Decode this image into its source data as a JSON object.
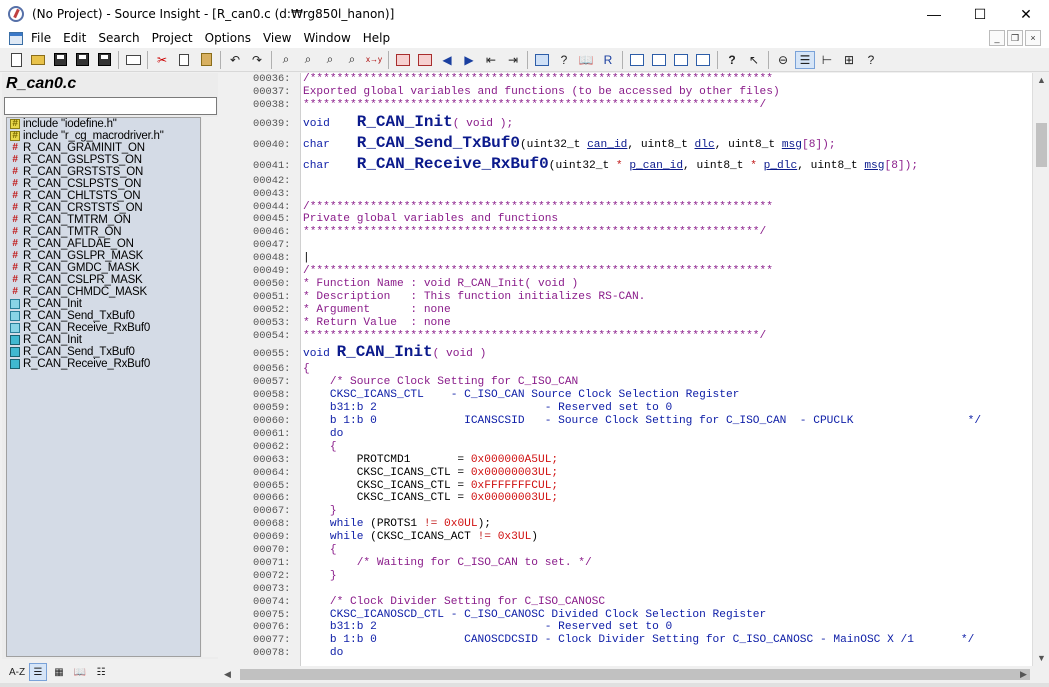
{
  "window": {
    "title": "(No Project) - Source Insight - [R_can0.c (d:₩rg850l_hanon)]",
    "minimize": "—",
    "maximize": "☐",
    "close": "✕"
  },
  "menu": [
    "File",
    "Edit",
    "Search",
    "Project",
    "Options",
    "View",
    "Window",
    "Help"
  ],
  "mdi": {
    "min": "_",
    "restore": "❒",
    "close": "×"
  },
  "toolbar_icons": [
    "new-file-icon",
    "open-folder-icon",
    "save-icon",
    "save-all-icon",
    "save-as-icon",
    "print-icon",
    "cut-icon",
    "copy-icon",
    "paste-icon",
    "undo-icon",
    "redo-icon",
    "find-icon",
    "find-next-icon",
    "find-prev-icon",
    "find-in-files-icon",
    "replace-icon",
    "bookmark-prev-icon",
    "bookmark-next-icon",
    "back-icon",
    "forward-icon",
    "indent-left-icon",
    "indent-right-icon",
    "lookup-icon",
    "references-icon",
    "browse-icon",
    "relation-icon",
    "symbol-window-icon",
    "context-window-icon",
    "relation-window-icon",
    "project-window-icon",
    "help-icon",
    "pointer-help-icon",
    "sync-icon",
    "layout-icon",
    "tree-icon",
    "layout-toggle-icon"
  ],
  "sidebar": {
    "file_title": "R_can0.c",
    "search_value": "",
    "symbols": [
      {
        "kind": "include",
        "label": "include \"iodefine.h\""
      },
      {
        "kind": "include",
        "label": "include \"r_cg_macrodriver.h\""
      },
      {
        "kind": "define",
        "label": "R_CAN_GRAMINIT_ON"
      },
      {
        "kind": "define",
        "label": "R_CAN_GSLPSTS_ON"
      },
      {
        "kind": "define",
        "label": "R_CAN_GRSTSTS_ON"
      },
      {
        "kind": "define",
        "label": "R_CAN_CSLPSTS_ON"
      },
      {
        "kind": "define",
        "label": "R_CAN_CHLTSTS_ON"
      },
      {
        "kind": "define",
        "label": "R_CAN_CRSTSTS_ON"
      },
      {
        "kind": "define",
        "label": "R_CAN_TMTRM_ON"
      },
      {
        "kind": "define",
        "label": "R_CAN_TMTR_ON"
      },
      {
        "kind": "define",
        "label": "R_CAN_AFLDAE_ON"
      },
      {
        "kind": "define",
        "label": "R_CAN_GSLPR_MASK"
      },
      {
        "kind": "define",
        "label": "R_CAN_GMDC_MASK"
      },
      {
        "kind": "define",
        "label": "R_CAN_CSLPR_MASK"
      },
      {
        "kind": "define",
        "label": "R_CAN_CHMDC_MASK"
      },
      {
        "kind": "proto",
        "label": "R_CAN_Init"
      },
      {
        "kind": "proto",
        "label": "R_CAN_Send_TxBuf0"
      },
      {
        "kind": "proto",
        "label": "R_CAN_Receive_RxBuf0"
      },
      {
        "kind": "func",
        "label": "R_CAN_Init"
      },
      {
        "kind": "func",
        "label": "R_CAN_Send_TxBuf0"
      },
      {
        "kind": "func",
        "label": "R_CAN_Receive_RxBuf0"
      }
    ],
    "bottom_buttons": [
      {
        "name": "sort-az-button",
        "label": "A-Z"
      },
      {
        "name": "list-view-button",
        "label": "☰"
      },
      {
        "name": "category-button",
        "label": "▦"
      },
      {
        "name": "book-button",
        "label": "📖"
      },
      {
        "name": "properties-button",
        "label": "☷"
      }
    ]
  },
  "editor": {
    "lines": [
      {
        "n": "00036:",
        "parts": [
          {
            "c": "cm",
            "t": "/*********************************************************************"
          }
        ]
      },
      {
        "n": "00037:",
        "parts": [
          {
            "c": "cm",
            "t": "Exported global variables and functions (to be accessed by other files)"
          }
        ]
      },
      {
        "n": "00038:",
        "parts": [
          {
            "c": "cm",
            "t": "********************************************************************/"
          }
        ]
      },
      {
        "n": "00039:",
        "parts": [
          {
            "c": "kw",
            "t": "void    "
          },
          {
            "c": "fnbig",
            "t": "R_CAN_Init"
          },
          {
            "c": "par",
            "t": "( void );"
          }
        ]
      },
      {
        "n": "00040:",
        "parts": [
          {
            "c": "kw",
            "t": "char    "
          },
          {
            "c": "fnbig",
            "t": "R_CAN_Send_TxBuf0"
          },
          {
            "c": "var",
            "t": "(uint32_t "
          },
          {
            "c": "pm",
            "t": "can_id"
          },
          {
            "c": "var",
            "t": ", uint8_t "
          },
          {
            "c": "pm",
            "t": "dlc"
          },
          {
            "c": "var",
            "t": ", uint8_t "
          },
          {
            "c": "pm",
            "t": "msg"
          },
          {
            "c": "par",
            "t": "[8]);"
          }
        ]
      },
      {
        "n": "00041:",
        "parts": [
          {
            "c": "kw",
            "t": "char    "
          },
          {
            "c": "fnbig",
            "t": "R_CAN_Receive_RxBuf0"
          },
          {
            "c": "var",
            "t": "(uint32_t "
          },
          {
            "c": "op",
            "t": "* "
          },
          {
            "c": "pm",
            "t": "p_can_id"
          },
          {
            "c": "var",
            "t": ", uint8_t "
          },
          {
            "c": "op",
            "t": "* "
          },
          {
            "c": "pm",
            "t": "p_dlc"
          },
          {
            "c": "var",
            "t": ", uint8_t "
          },
          {
            "c": "pm",
            "t": "msg"
          },
          {
            "c": "par",
            "t": "[8]);"
          }
        ]
      },
      {
        "n": "00042:",
        "parts": []
      },
      {
        "n": "00043:",
        "parts": []
      },
      {
        "n": "00044:",
        "parts": [
          {
            "c": "cm",
            "t": "/*********************************************************************"
          }
        ]
      },
      {
        "n": "00045:",
        "parts": [
          {
            "c": "cm",
            "t": "Private global variables and functions"
          }
        ]
      },
      {
        "n": "00046:",
        "parts": [
          {
            "c": "cm",
            "t": "********************************************************************/"
          }
        ]
      },
      {
        "n": "00047:",
        "parts": []
      },
      {
        "n": "00048:",
        "parts": [
          {
            "c": "var",
            "t": "|"
          }
        ]
      },
      {
        "n": "00049:",
        "parts": [
          {
            "c": "cm",
            "t": "/*********************************************************************"
          }
        ]
      },
      {
        "n": "00050:",
        "parts": [
          {
            "c": "cm",
            "t": "* Function Name : void R_CAN_Init( void )"
          }
        ]
      },
      {
        "n": "00051:",
        "parts": [
          {
            "c": "cm",
            "t": "* Description   : This function initializes RS-CAN."
          }
        ]
      },
      {
        "n": "00052:",
        "parts": [
          {
            "c": "cm",
            "t": "* Argument      : none"
          }
        ]
      },
      {
        "n": "00053:",
        "parts": [
          {
            "c": "cm",
            "t": "* Return Value  : none"
          }
        ]
      },
      {
        "n": "00054:",
        "parts": [
          {
            "c": "cm",
            "t": "********************************************************************/"
          }
        ]
      },
      {
        "n": "00055:",
        "parts": [
          {
            "c": "kw",
            "t": "void "
          },
          {
            "c": "fnbig",
            "t": "R_CAN_Init"
          },
          {
            "c": "par",
            "t": "( void )"
          }
        ]
      },
      {
        "n": "00056:",
        "parts": [
          {
            "c": "par",
            "t": "{"
          }
        ]
      },
      {
        "n": "00057:",
        "parts": [
          {
            "c": "cm",
            "t": "    /* Source Clock Setting for C_ISO_CAN"
          }
        ]
      },
      {
        "n": "00058:",
        "parts": [
          {
            "c": "kw",
            "t": "    CKSC_ICANS_CTL    - C_ISO_CAN Source Clock Selection Register"
          }
        ]
      },
      {
        "n": "00059:",
        "parts": [
          {
            "c": "kw",
            "t": "    b31:b 2                         - Reserved set to 0"
          }
        ]
      },
      {
        "n": "00060:",
        "parts": [
          {
            "c": "kw",
            "t": "    b 1:b 0             ICANSCSID   - Source Clock Setting for C_ISO_CAN  - CPUCLK                 */"
          }
        ]
      },
      {
        "n": "00061:",
        "parts": [
          {
            "c": "kw",
            "t": "    do"
          }
        ]
      },
      {
        "n": "00062:",
        "parts": [
          {
            "c": "par",
            "t": "    {"
          }
        ]
      },
      {
        "n": "00063:",
        "parts": [
          {
            "c": "var",
            "t": "        PROTCMD1       = "
          },
          {
            "c": "num",
            "t": "0x000000A5UL;"
          }
        ]
      },
      {
        "n": "00064:",
        "parts": [
          {
            "c": "var",
            "t": "        CKSC_ICANS_CTL = "
          },
          {
            "c": "num",
            "t": "0x00000003UL;"
          }
        ]
      },
      {
        "n": "00065:",
        "parts": [
          {
            "c": "var",
            "t": "        CKSC_ICANS_CTL = "
          },
          {
            "c": "num",
            "t": "0xFFFFFFFCUL;"
          }
        ]
      },
      {
        "n": "00066:",
        "parts": [
          {
            "c": "var",
            "t": "        CKSC_ICANS_CTL = "
          },
          {
            "c": "num",
            "t": "0x00000003UL;"
          }
        ]
      },
      {
        "n": "00067:",
        "parts": [
          {
            "c": "par",
            "t": "    }"
          }
        ]
      },
      {
        "n": "00068:",
        "parts": [
          {
            "c": "kw",
            "t": "    while "
          },
          {
            "c": "var",
            "t": "(PROTS1 "
          },
          {
            "c": "op",
            "t": "!= "
          },
          {
            "c": "num",
            "t": "0x0UL"
          },
          {
            "c": "var",
            "t": ");"
          }
        ]
      },
      {
        "n": "00069:",
        "parts": [
          {
            "c": "kw",
            "t": "    while "
          },
          {
            "c": "var",
            "t": "(CKSC_ICANS_ACT "
          },
          {
            "c": "op",
            "t": "!= "
          },
          {
            "c": "num",
            "t": "0x3UL"
          },
          {
            "c": "var",
            "t": ")"
          }
        ]
      },
      {
        "n": "00070:",
        "parts": [
          {
            "c": "par",
            "t": "    {"
          }
        ]
      },
      {
        "n": "00071:",
        "parts": [
          {
            "c": "cm",
            "t": "        /* Waiting for C_ISO_CAN to set. */"
          }
        ]
      },
      {
        "n": "00072:",
        "parts": [
          {
            "c": "par",
            "t": "    }"
          }
        ]
      },
      {
        "n": "00073:",
        "parts": []
      },
      {
        "n": "00074:",
        "parts": [
          {
            "c": "cm",
            "t": "    /* Clock Divider Setting for C_ISO_CANOSC"
          }
        ]
      },
      {
        "n": "00075:",
        "parts": [
          {
            "c": "kw",
            "t": "    CKSC_ICANOSCD_CTL - C_ISO_CANOSC Divided Clock Selection Register"
          }
        ]
      },
      {
        "n": "00076:",
        "parts": [
          {
            "c": "kw",
            "t": "    b31:b 2                         - Reserved set to 0"
          }
        ]
      },
      {
        "n": "00077:",
        "parts": [
          {
            "c": "kw",
            "t": "    b 1:b 0             CANOSCDCSID - Clock Divider Setting for C_ISO_CANOSC - MainOSC X /1       */"
          }
        ]
      },
      {
        "n": "00078:",
        "parts": [
          {
            "c": "kw",
            "t": "    do"
          }
        ]
      }
    ]
  }
}
